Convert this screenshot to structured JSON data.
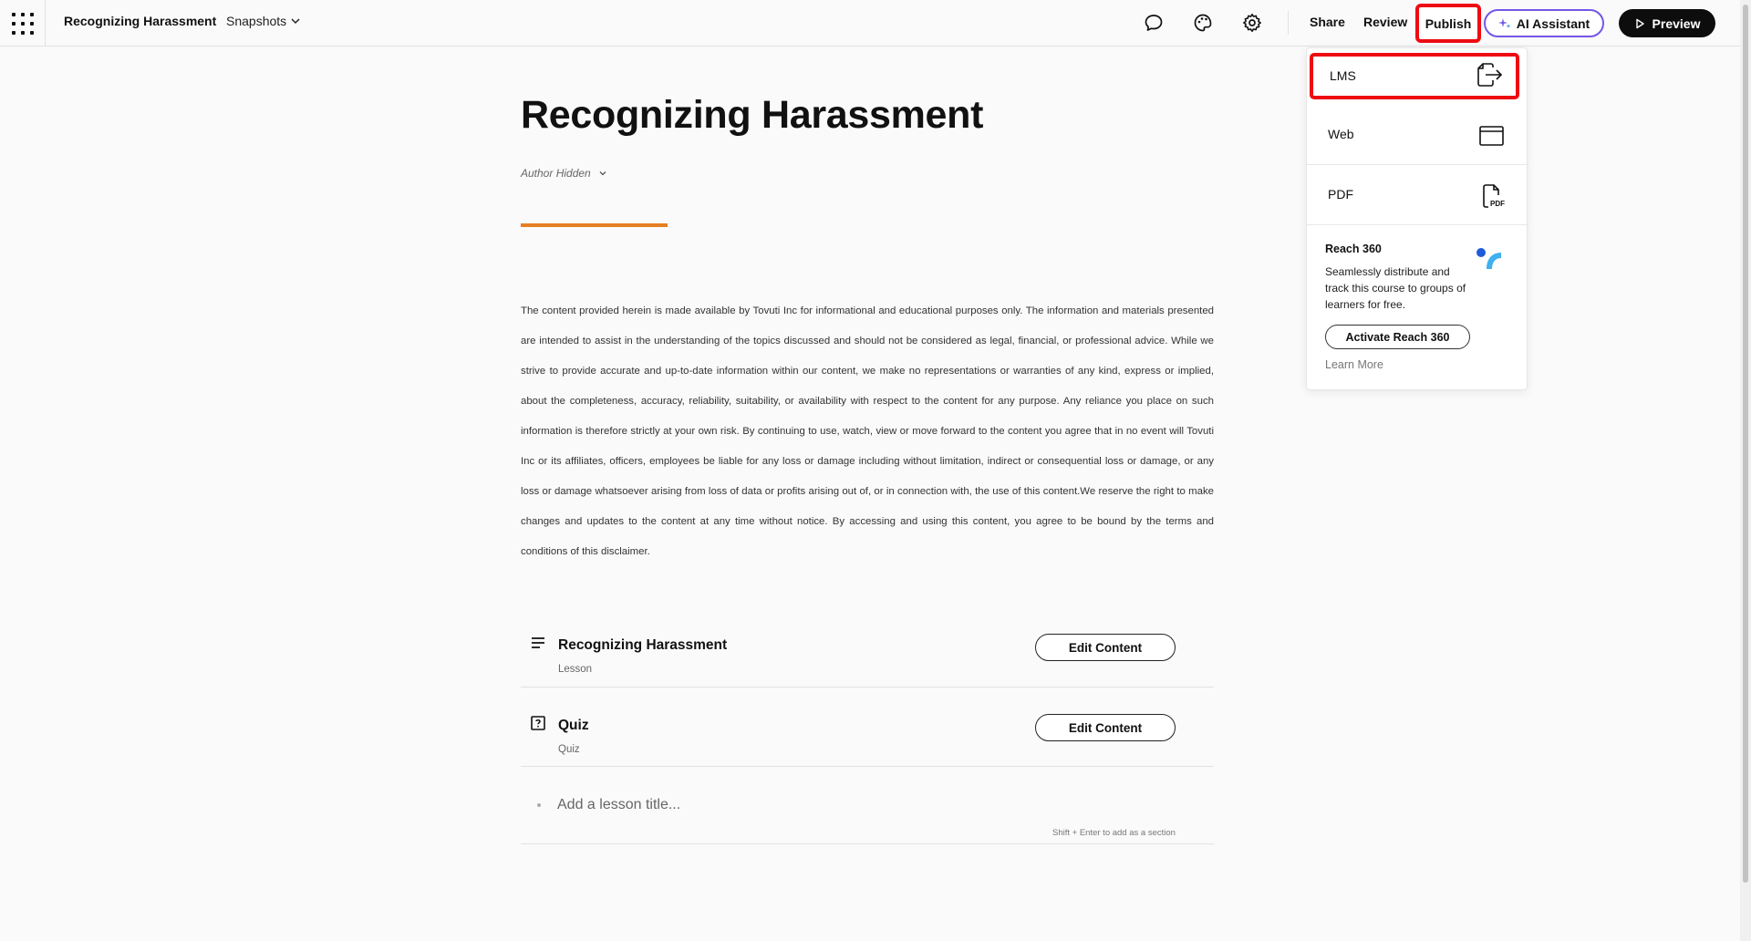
{
  "header": {
    "course_title": "Recognizing Harassment",
    "snapshots_label": "Snapshots",
    "share_label": "Share",
    "review_label": "Review",
    "publish_label": "Publish",
    "ai_assistant_label": "AI Assistant",
    "preview_label": "Preview"
  },
  "course": {
    "title": "Recognizing Harassment",
    "author": "Author Hidden",
    "accent_color": "#e67e22",
    "disclaimer": "The content provided herein is made available by Tovuti Inc for informational and educational purposes only. The information and materials presented are intended to assist in the understanding of the topics discussed and should not be considered as legal, financial, or professional advice. While we strive to provide accurate and up-to-date information within our content, we make no representations or warranties of any kind, express or implied, about the completeness, accuracy, reliability, suitability, or availability with respect to the content for any purpose. Any reliance you place on such information is therefore strictly at your own risk. By continuing to use, watch, view or move forward to the content you agree that in no event will Tovuti Inc or its affiliates, officers, employees be liable for any loss or damage including without limitation, indirect or consequential loss or damage, or any loss or damage whatsoever arising from loss of data or profits arising out of, or in connection with, the use of this content.We reserve the right to make changes and updates to the content at any time without notice. By accessing and using this content, you agree to be bound by the terms and conditions of this disclaimer."
  },
  "lessons": [
    {
      "title": "Recognizing Harassment",
      "type": "Lesson",
      "icon": "lines-icon",
      "button": "Edit Content"
    },
    {
      "title": "Quiz",
      "type": "Quiz",
      "icon": "question-box-icon",
      "button": "Edit Content"
    }
  ],
  "add_lesson": {
    "placeholder": "Add a lesson title...",
    "hint": "Shift + Enter to add as a section"
  },
  "publish_menu": {
    "items": [
      {
        "label": "LMS",
        "icon": "export-file-icon"
      },
      {
        "label": "Web",
        "icon": "browser-window-icon"
      },
      {
        "label": "PDF",
        "icon": "pdf-file-icon"
      }
    ],
    "reach": {
      "title": "Reach 360",
      "description": "Seamlessly distribute and track this course to groups of learners for free.",
      "button": "Activate Reach 360",
      "learn_more": "Learn More"
    }
  },
  "colors": {
    "highlight_red": "#ee0b12",
    "ai_purple": "#7456e8",
    "reach_blue": "#1e88e5"
  }
}
